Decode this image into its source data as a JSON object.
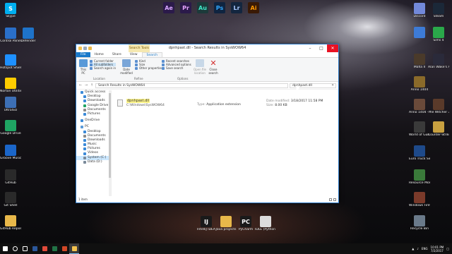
{
  "desktop_left": [
    {
      "label": "Skype",
      "icon": "skype-icon",
      "color": "#00aff0",
      "letter": "S"
    },
    {
      "label": "Control Panel",
      "icon": "control-panel-icon",
      "color": "#2a6fc9",
      "letter": ""
    },
    {
      "label": "Hotspot Shield",
      "icon": "hotspot-shield-icon",
      "color": "#1e90ff",
      "letter": ""
    },
    {
      "label": "Norton Utilities 16",
      "icon": "norton-icon",
      "color": "#ffcc00",
      "letter": ""
    },
    {
      "label": "UltraISO",
      "icon": "ultraiso-icon",
      "color": "#3d6fb5",
      "letter": ""
    },
    {
      "label": "Google Drive",
      "icon": "google-drive-icon",
      "color": "#1fa463",
      "letter": ""
    },
    {
      "label": "Groove Music",
      "icon": "groove-music-icon",
      "color": "#1b66c9",
      "letter": ""
    },
    {
      "label": "GitHub",
      "icon": "github-icon",
      "color": "#2a2a2a",
      "letter": ""
    },
    {
      "label": "Git Shell",
      "icon": "git-shell-icon",
      "color": "#2a2a2a",
      "letter": ""
    },
    {
      "label": "GitHub Repos",
      "icon": "folder-icon",
      "color": "#e8b84a",
      "letter": ""
    }
  ],
  "desktop_col2": [
    {
      "label": "Defender",
      "icon": "defender-icon",
      "color": "#1e73c9",
      "letter": ""
    }
  ],
  "desktop_top": [
    {
      "label": "Ae",
      "icon": "after-effects-icon",
      "color": "#2b1a4a",
      "fg": "#d8a6ff"
    },
    {
      "label": "Pr",
      "icon": "premiere-icon",
      "color": "#2b1a4a",
      "fg": "#e6a3ff"
    },
    {
      "label": "Au",
      "icon": "audition-icon",
      "color": "#1c3a3a",
      "fg": "#3fe6c6"
    },
    {
      "label": "Ps",
      "icon": "photoshop-icon",
      "color": "#0f2440",
      "fg": "#31a8ff"
    },
    {
      "label": "Lr",
      "icon": "lightroom-icon",
      "color": "#13263f",
      "fg": "#a9c9ff"
    },
    {
      "label": "Ai",
      "icon": "illustrator-icon",
      "color": "#3a1a06",
      "fg": "#ff9a00"
    }
  ],
  "desktop_right_col1": [
    {
      "label": "Discord",
      "icon": "discord-icon",
      "color": "#7289da"
    },
    {
      "label": "",
      "icon": "network-icon",
      "color": "#3d7bd6"
    },
    {
      "label": "Mafia II",
      "icon": "mafia-icon",
      "color": "#4a3a2a"
    },
    {
      "label": "Anno 1404",
      "icon": "anno-1404-icon",
      "color": "#8a6a2a"
    },
    {
      "label": "Anno 1404 - Venice",
      "icon": "anno-venice-icon",
      "color": "#6a4a3a"
    },
    {
      "label": "World of Gun: Gun...",
      "icon": "world-of-guns-icon",
      "color": "#3a3a3a"
    },
    {
      "label": "Euro Truck Simulator 2",
      "icon": "euro-truck-icon",
      "color": "#1e4a8a"
    },
    {
      "label": "Resource Monitor",
      "icon": "resource-monitor-icon",
      "color": "#3a7a3a"
    },
    {
      "label": "Windows Firewall wi...",
      "icon": "firewall-icon",
      "color": "#7a3a2a"
    },
    {
      "label": "Recycle Bin",
      "icon": "recycle-bin-icon",
      "color": "#6a7a8a"
    }
  ],
  "desktop_right_col2": [
    {
      "label": "Steam",
      "icon": "steam-icon",
      "color": "#1b2838"
    },
    {
      "label": "Sims 4",
      "icon": "sims-4-icon",
      "color": "#2aa84a"
    },
    {
      "label": "Alan Wake's American...",
      "icon": "alan-wake-icon",
      "color": "#2a2a3a"
    },
    {
      "label": "The Witcher 3: Wild Hunt",
      "icon": "witcher-icon",
      "color": "#5a3a2a"
    },
    {
      "label": "Counter-Strike Global Offe...",
      "icon": "csgo-icon",
      "color": "#c8a040"
    }
  ],
  "desktop_bottom": [
    {
      "label": "IntelliJ IDEA",
      "icon": "intellij-icon",
      "color": "#1a1a1a",
      "letter": "IJ"
    },
    {
      "label": "Java projects",
      "icon": "folder-icon",
      "color": "#e8b84a",
      "letter": ""
    },
    {
      "label": "PyCharm",
      "icon": "pycharm-icon",
      "color": "#1a1a1a",
      "letter": "PC"
    },
    {
      "label": "IDLE (Python 3.6 32-bit)",
      "icon": "idle-icon",
      "color": "#dcdcdc",
      "letter": ""
    }
  ],
  "window": {
    "title": "dpnhpast.dll - Search Results in SysWOW64",
    "context_tab": "Search Tools",
    "tabs": [
      "File",
      "Home",
      "Share",
      "View",
      "Search"
    ],
    "ribbon": {
      "this_pc": "This PC",
      "current_folder": "Current folder",
      "all_subfolders": "All subfolders",
      "search_again_in": "Search again in",
      "location": "Location",
      "date_modified": "Date modified",
      "kind": "Kind",
      "size": "Size",
      "other_properties": "Other properties",
      "refine": "Refine",
      "recent_searches": "Recent searches",
      "advanced_options": "Advanced options",
      "save_search": "Save search",
      "open_file_location": "Open file location",
      "close_search": "Close search",
      "options": "Options"
    },
    "address": "Search Results in SysWOW64",
    "search_query": "dpnhpast.dll",
    "nav": {
      "quick_access": "Quick access",
      "items": [
        {
          "label": "Desktop",
          "icon": "desktop-icon",
          "color": "#3b8ad8"
        },
        {
          "label": "Downloads",
          "icon": "downloads-icon",
          "color": "#3b8ad8"
        },
        {
          "label": "Google Drive",
          "icon": "google-drive-icon",
          "color": "#1fa463"
        },
        {
          "label": "Documents",
          "icon": "documents-icon",
          "color": "#8a8a8a"
        },
        {
          "label": "Pictures",
          "icon": "pictures-icon",
          "color": "#3b8ad8"
        }
      ],
      "onedrive": "OneDrive",
      "this_pc": "PC",
      "pc_items": [
        {
          "label": "Desktop",
          "icon": "desktop-icon",
          "color": "#3b8ad8"
        },
        {
          "label": "Documents",
          "icon": "documents-icon",
          "color": "#8a8a8a"
        },
        {
          "label": "Downloads",
          "icon": "downloads-icon",
          "color": "#3b8ad8"
        },
        {
          "label": "Music",
          "icon": "music-icon",
          "color": "#3b8ad8"
        },
        {
          "label": "Pictures",
          "icon": "pictures-icon",
          "color": "#3b8ad8"
        },
        {
          "label": "Videos",
          "icon": "videos-icon",
          "color": "#3b8ad8"
        },
        {
          "label": "System (C:)",
          "icon": "drive-c-icon",
          "color": "#7a8a9a"
        },
        {
          "label": "Data (D:)",
          "icon": "drive-d-icon",
          "color": "#7a8a9a"
        }
      ]
    },
    "result": {
      "name": "dpnhpast.dll",
      "path": "C:\\Windows\\SysWOW64",
      "type_label": "Type:",
      "type_value": "Application extension",
      "date_label": "Date modified:",
      "date_value": "3/18/2017 11:58 PM",
      "size_label": "Size:",
      "size_value": "8.00 KB"
    },
    "status": "1 item"
  },
  "taskbar": {
    "items": [
      {
        "icon": "start-icon",
        "color": "#ffffff"
      },
      {
        "icon": "cortana-icon",
        "color": "#ffffff"
      },
      {
        "icon": "task-view-icon",
        "color": "#ffffff"
      },
      {
        "icon": "word-icon",
        "color": "#2b579a"
      },
      {
        "icon": "chrome-icon",
        "color": "#e04a3a"
      },
      {
        "icon": "excel-icon",
        "color": "#217346"
      },
      {
        "icon": "powerpoint-icon",
        "color": "#d24726"
      },
      {
        "icon": "file-explorer-icon",
        "color": "#f2c14e"
      }
    ],
    "lang": "ENG",
    "time": "10:01 PM",
    "date": "7/2/2017"
  }
}
